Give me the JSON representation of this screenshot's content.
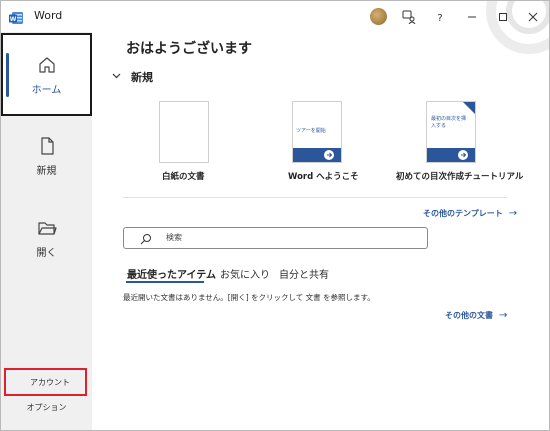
{
  "app": {
    "title": "Word"
  },
  "sidebar": {
    "items": [
      {
        "label": "ホーム"
      },
      {
        "label": "新規"
      },
      {
        "label": "開く"
      }
    ],
    "account_label": "アカウント",
    "options_label": "オプション"
  },
  "main": {
    "greeting": "おはようございます",
    "new_section_title": "新規",
    "templates": [
      {
        "label": "白紙の文書",
        "thumb_text": ""
      },
      {
        "label": "Word へようこそ",
        "thumb_text": "ツアーを開始"
      },
      {
        "label": "初めての目次作成チュートリアル",
        "thumb_text": "最初の目次を挿入する"
      }
    ],
    "more_templates": "その他のテンプレート",
    "search_placeholder": "検索",
    "tabs": [
      {
        "label": "最近使ったアイテム",
        "active": true
      },
      {
        "label": "お気に入り",
        "active": false
      },
      {
        "label": "自分と共有",
        "active": false
      }
    ],
    "empty_message": "最近開いた文書はありません。[開く] をクリックして 文書 を参照します。",
    "more_documents": "その他の文書"
  },
  "colors": {
    "accent": "#2b579a",
    "highlight_border": "#e0212c",
    "sidebar_bg": "#f0f0f0"
  },
  "icons": [
    "word-app-icon",
    "home-icon",
    "new-document-icon",
    "open-folder-icon",
    "search-icon",
    "coauthor-icon",
    "help-icon",
    "minimize-icon",
    "maximize-icon",
    "close-icon"
  ]
}
